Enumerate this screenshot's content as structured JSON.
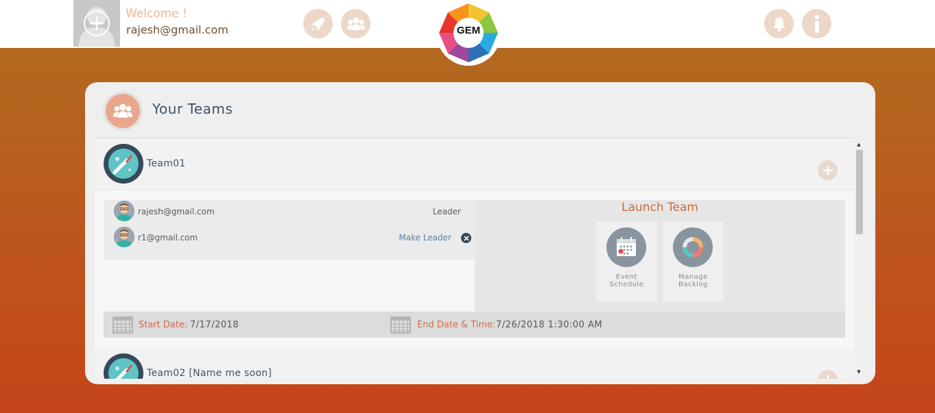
{
  "header": {
    "welcome": "Welcome !",
    "email": "rajesh@gmail.com",
    "logo_text": "GEM",
    "icons": [
      "rocket-icon",
      "team-icon",
      "bell-icon",
      "info-icon"
    ]
  },
  "card": {
    "title": "Your Teams",
    "icon": "team-icon"
  },
  "teams": [
    {
      "name": "Team01",
      "members": [
        {
          "email": "rajesh@gmail.com",
          "role": "Leader"
        },
        {
          "email": "r1@gmail.com",
          "action": "Make Leader"
        }
      ],
      "launch": {
        "title": "Launch Team",
        "tiles": [
          {
            "label": "Event\nSchedule",
            "icon": "calendar-icon"
          },
          {
            "label": "Manage\nBacklog",
            "icon": "cycle-icon"
          }
        ]
      },
      "start_label": "Start Date:",
      "start_value": "7/17/2018",
      "end_label": "End Date & Time:",
      "end_value": "7/26/2018 1:30:00 AM"
    },
    {
      "name": "Team02 [Name me soon]"
    }
  ],
  "colors": {
    "accent": "#c96a3f",
    "bg_top": "#b2691f",
    "bg_bottom": "#c6441a",
    "title": "#3f5164"
  }
}
